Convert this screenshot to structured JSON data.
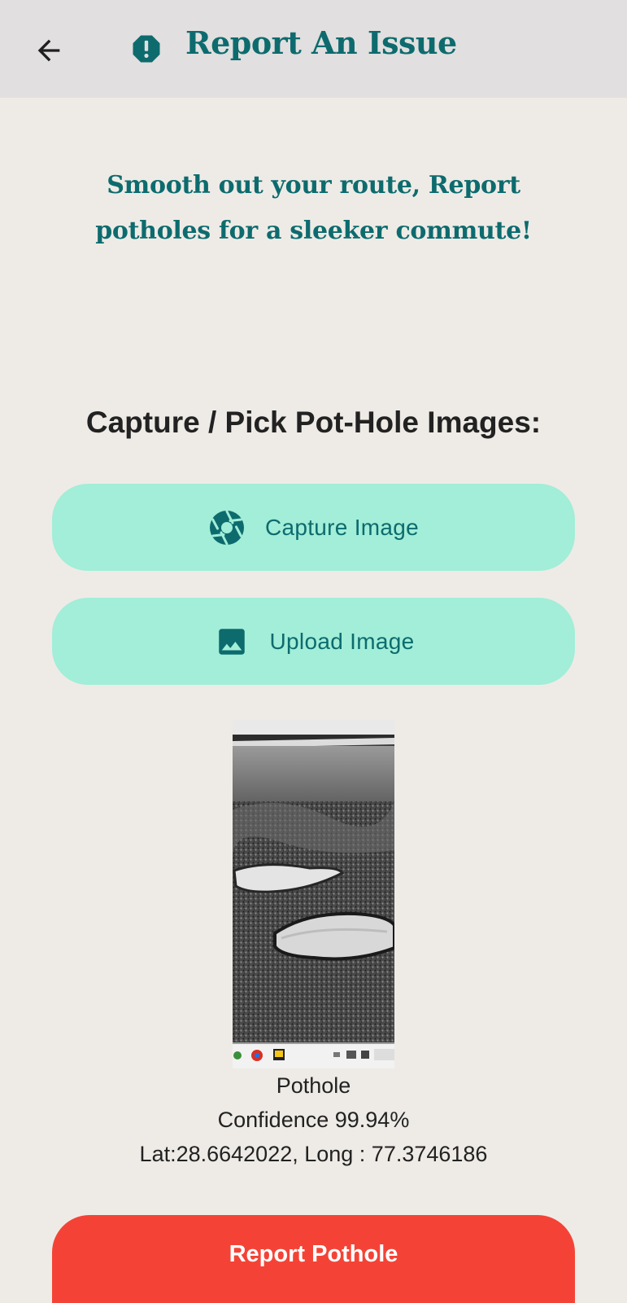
{
  "header": {
    "title": "Report An Issue",
    "back_icon": "arrow-back-icon",
    "title_icon": "report-octagon-icon",
    "background": "#e1dfdf",
    "accent": "#0d6b6e"
  },
  "tagline": "Smooth out your route, Report potholes for a sleeker commute!",
  "section_heading": "Capture / Pick Pot-Hole Images:",
  "buttons": {
    "capture": {
      "label": "Capture Image",
      "icon": "camera-shutter-icon"
    },
    "upload": {
      "label": "Upload Image",
      "icon": "image-icon"
    },
    "color": "#a2eed8"
  },
  "detection": {
    "label": "Pothole",
    "confidence": "Confidence 99.94%",
    "location": "Lat:28.6642022, Long : 77.3746186"
  },
  "report_button": {
    "label": "Report Pothole",
    "color": "#f44336"
  }
}
